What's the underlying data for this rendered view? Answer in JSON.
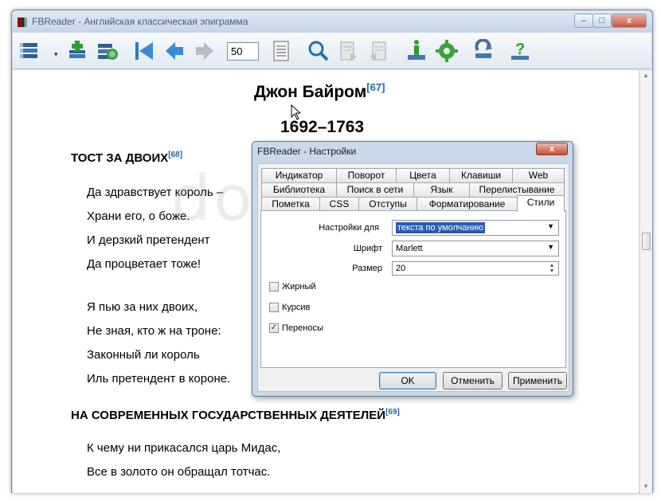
{
  "window": {
    "title": "FBReader - Английская классическая эпиграмма",
    "controls": {
      "minimize": "–",
      "maximize": "□",
      "close": "x"
    }
  },
  "toolbar": {
    "icons": [
      "library-icon",
      "add-book-icon",
      "network-library-icon",
      "first-page-icon",
      "back-icon",
      "forward-icon",
      "page-number",
      "toc-icon",
      "search-icon",
      "find-next-icon",
      "find-previous-icon",
      "book-info-icon",
      "settings-icon",
      "rotate-icon",
      "help-icon"
    ],
    "page_value": "50",
    "dropdown_arrow": "▾"
  },
  "book": {
    "author": "Джон Байром",
    "author_fn": "[67]",
    "years": "1692–1763",
    "section1": {
      "title": "ТОСТ ЗА ДВОИХ",
      "fn": "[68]"
    },
    "stanza1": [
      "Да здравствует король –",
      "Храни его, о боже.",
      "И дерзкий претендент",
      "Да процветает тоже!"
    ],
    "stanza2": [
      "Я пью за них двоих,",
      "Не зная, кто ж на троне:",
      "Законный ли король",
      "Иль претендент в короне."
    ],
    "section2": {
      "title": "НА СОВРЕМЕННЫХ ГОСУДАРСТВЕННЫХ ДЕЯТЕЛЕЙ",
      "fn": "[69]"
    },
    "stanza3": [
      "К чему ни прикасался царь Мидас,",
      "Все в золото он обращал тотчас."
    ]
  },
  "watermark": "downz.ru",
  "dialog": {
    "title": "FBReader - Настройки",
    "close": "x",
    "tabs_row1": [
      "Индикатор",
      "Поворот",
      "Цвета",
      "Клавиши",
      "Web"
    ],
    "tabs_row2": [
      "Библиотека",
      "Поиск в сети",
      "Язык",
      "Перелистывание"
    ],
    "tabs_row3": [
      "Пометка",
      "CSS",
      "Отступы",
      "Форматирование",
      "Стили"
    ],
    "active_tab": "Стили",
    "settings_for_label": "Настройки для",
    "settings_for_value": "текста по умолчанию",
    "font_label": "Шрифт",
    "font_value": "Marlett",
    "size_label": "Размер",
    "size_value": "20",
    "bold_label": "Жирный",
    "bold_checked": false,
    "italic_label": "Курсив",
    "italic_checked": false,
    "hyphen_label": "Переносы",
    "hyphen_checked": true,
    "check_mark": "✓",
    "ok": "OK",
    "cancel": "Отменить",
    "apply": "Применить"
  }
}
